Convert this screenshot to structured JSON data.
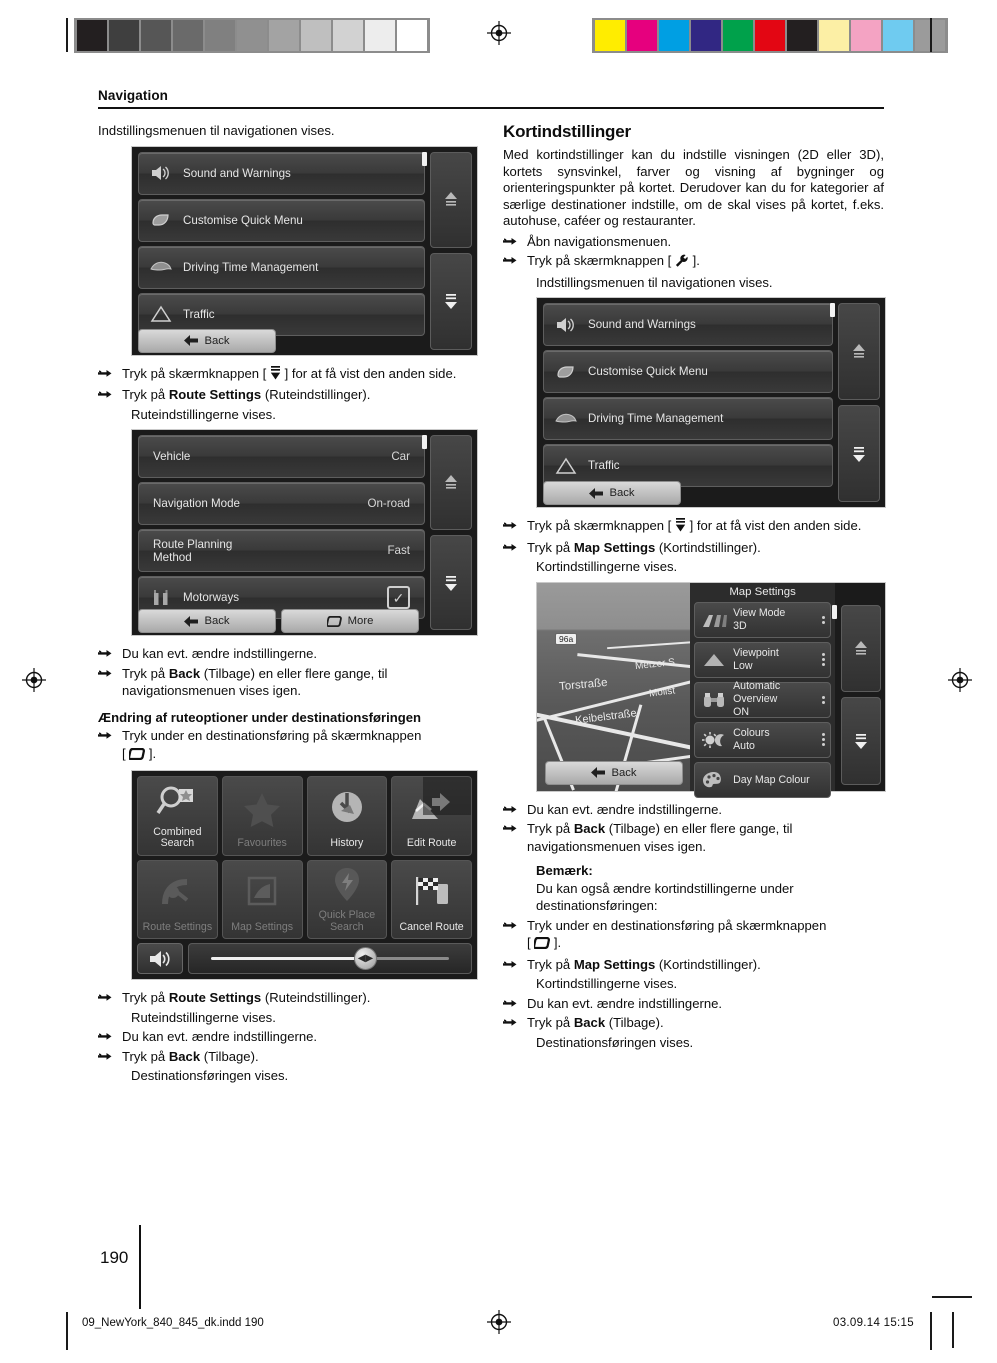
{
  "document": {
    "header_title": "Navigation",
    "page_number": "190",
    "footer_file": "09_NewYork_840_845_dk.indd   190",
    "footer_date": "03.09.14   15:15"
  },
  "calibration": {
    "grayscale_swatches": [
      "#231f20",
      "#3f3f3f",
      "#565656",
      "#6a6a6a",
      "#808080",
      "#909090",
      "#a3a3a3",
      "#bfbfbf",
      "#d2d2d2",
      "#ededed",
      "#ffffff"
    ],
    "color_swatches": [
      "#ffed00",
      "#e6007e",
      "#009fe3",
      "#312783",
      "#00a14b",
      "#e30613",
      "#231f20",
      "#fcefa5",
      "#f4a3c3",
      "#6fcbf0",
      "#9b9b9b"
    ]
  },
  "left_column": {
    "intro": "Indstillingsmenuen til navigationen vises.",
    "steps_after_settings": [
      {
        "text_before": "Tryk på skærmknappen [ ",
        "icon": "page-down-icon",
        "text_after": " ] for at få vist den anden side."
      },
      {
        "text_before": "Tryk på ",
        "bold": "Route Settings",
        "text_after": " (Ruteindstillinger)."
      }
    ],
    "route_settings_result": "Ruteindstillingerne vises.",
    "after_route_settings": [
      {
        "text": "Du kan evt. ændre indstillingerne."
      },
      {
        "text": "Tryk på ",
        "bold": "Back",
        "text_after": " (Tilbage) en eller flere gange, til navigationsmenuen vises igen."
      }
    ],
    "subheading": "Ændring af ruteoptioner under destinationsføringen",
    "guidance_step": {
      "text_before": "Tryk under en destinationsføring på skærmknappen [ ",
      "icon": "quick-menu-icon",
      "text_after": " ]."
    },
    "closing_steps": [
      {
        "text": "Tryk på ",
        "bold": "Route Settings",
        "text_after": " (Ruteindstillinger)."
      },
      {
        "sub": "Ruteindstillingerne vises."
      },
      {
        "text": "Du kan evt. ændre indstillingerne."
      },
      {
        "text": "Tryk på ",
        "bold": "Back",
        "text_after": " (Tilbage)."
      },
      {
        "sub": "Destinationsføringen vises."
      }
    ]
  },
  "right_column": {
    "heading": "Kortindstillinger",
    "paragraph": "Med kortindstillinger kan du indstille visningen (2D eller 3D), kortets synsvinkel, farver og visning af bygninger og orienteringspunkter på kortet. Derudover kan du for kategorier af særlige destinationer indstille, om de skal vises på kortet, f.eks. autohuse, caféer og restauranter.",
    "steps_open": [
      {
        "text": "Åbn navigationsmenuen."
      },
      {
        "text_before": "Tryk på skærmknappen [ ",
        "icon": "wrench-icon",
        "text_after": " ]."
      }
    ],
    "settings_result": "Indstillingsmenuen til navigationen vises.",
    "steps_map": [
      {
        "text_before": "Tryk på skærmknappen [ ",
        "icon": "page-down-icon",
        "text_after": " ] for at få vist den anden side."
      },
      {
        "text_before": "Tryk på ",
        "bold": "Map Settings",
        "text_after": " (Kortindstillinger)."
      }
    ],
    "map_result": "Kortindstillingerne vises.",
    "after_map": [
      {
        "text": "Du kan evt. ændre indstillingerne."
      },
      {
        "text": "Tryk på ",
        "bold": "Back",
        "text_after": " (Tilbage) en eller flere gange, til navigationsmenuen vises igen."
      }
    ],
    "note_heading": "Bemærk:",
    "note_body": "Du kan også ændre kortindstillingerne under destinationsføringen:",
    "note_steps": [
      {
        "text_before": "Tryk under en destinationsføring på skærmknappen [ ",
        "icon": "quick-menu-icon",
        "text_after": " ]."
      },
      {
        "text": "Tryk på ",
        "bold": "Map Settings",
        "text_after": " (Kortindstillinger)."
      },
      {
        "sub": "Kortindstillingerne vises."
      },
      {
        "text": "Du kan evt. ændre indstillingerne."
      },
      {
        "text": "Tryk på ",
        "bold": "Back",
        "text_after": " (Tilbage)."
      },
      {
        "sub": "Destinationsføringen vises."
      }
    ]
  },
  "screens": {
    "settings_menu": {
      "rows": [
        {
          "label": "Sound and Warnings",
          "icon": "speaker-icon"
        },
        {
          "label": "Customise Quick Menu",
          "icon": "leaf-icon"
        },
        {
          "label": "Driving Time Management",
          "icon": "steering-icon"
        },
        {
          "label": "Traffic",
          "icon": "warning-triangle-icon"
        }
      ],
      "back_label": "Back"
    },
    "route_settings": {
      "rows": [
        {
          "label": "Vehicle",
          "value": "Car"
        },
        {
          "label": "Navigation Mode",
          "value": "On-road"
        },
        {
          "label": "Route Planning",
          "label2": "Method",
          "value": "Fast"
        },
        {
          "label": "Motorways",
          "icon": "motorway-icon",
          "checked": true
        }
      ],
      "back_label": "Back",
      "more_label": "More"
    },
    "quick_menu": {
      "tiles": [
        {
          "label": "Combined",
          "label2": "Search",
          "icon": "combined-search-icon",
          "dimmed": false
        },
        {
          "label": "Favourites",
          "icon": "star-icon",
          "dimmed": true
        },
        {
          "label": "History",
          "icon": "history-icon",
          "dimmed": false
        },
        {
          "label": "Edit Route",
          "icon": "edit-route-icon",
          "dimmed": false
        },
        {
          "label": "Route Settings",
          "icon": "route-settings-icon",
          "dimmed": true
        },
        {
          "label": "Map Settings",
          "icon": "map-settings-icon",
          "dimmed": true
        },
        {
          "label": "Quick Place",
          "label2": "Search",
          "icon": "quick-place-icon",
          "dimmed": true
        },
        {
          "label": "Cancel Route",
          "icon": "checkered-flag-icon",
          "dimmed": false
        }
      ],
      "volume_icon": "volume-icon"
    },
    "map_settings": {
      "title": "Map Settings",
      "rows": [
        {
          "label": "View Mode",
          "value": "3D",
          "icon": "view-mode-icon"
        },
        {
          "label": "Viewpoint",
          "value": "Low",
          "icon": "viewpoint-icon"
        },
        {
          "label": "Automatic Overview",
          "value": "ON",
          "icon": "binoculars-icon"
        },
        {
          "label": "Colours",
          "value": "Auto",
          "icon": "sun-moon-icon"
        },
        {
          "label": "Day Map Colour",
          "value": "",
          "icon": "palette-icon"
        }
      ],
      "back_label": "Back",
      "map_labels": [
        "96a",
        "Metzer S",
        "Torstraße",
        "Mollst",
        "Keibelstraße"
      ]
    }
  }
}
